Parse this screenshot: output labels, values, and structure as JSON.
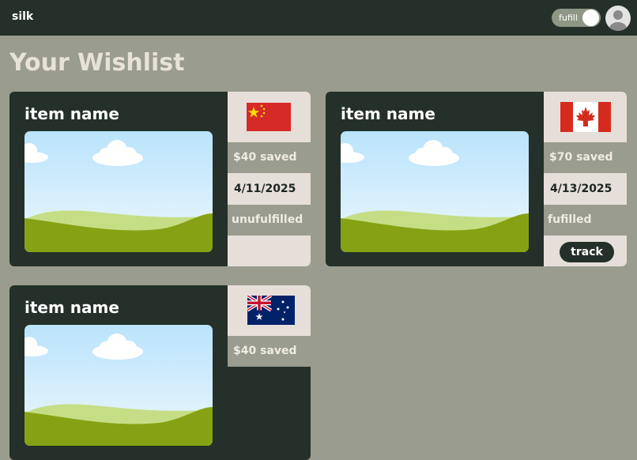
{
  "header": {
    "brand": "silk",
    "toggle_label": "fufill"
  },
  "page": {
    "title": "Your Wishlist"
  },
  "colors": {
    "background": "#999c8e",
    "dark": "#243029",
    "light_panel": "#e6dfd9"
  },
  "cards": [
    {
      "name": "item name",
      "flag": "china-flag-icon",
      "saved": "$40 saved",
      "date": "4/11/2025",
      "status": "unufulfilled"
    },
    {
      "name": "item name",
      "flag": "canada-flag-icon",
      "saved": "$70 saved",
      "date": "4/13/2025",
      "status": "fufilled",
      "action_label": "track"
    },
    {
      "name": "item name",
      "flag": "australia-flag-icon",
      "saved": "$40 saved"
    }
  ]
}
